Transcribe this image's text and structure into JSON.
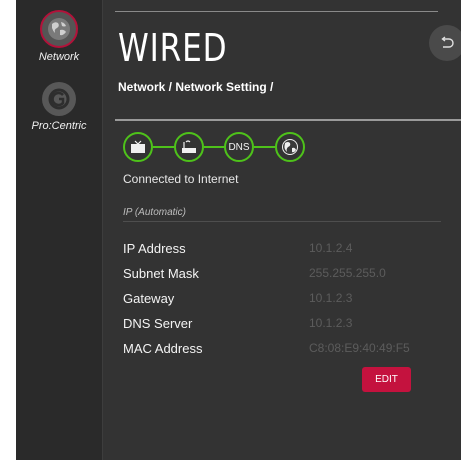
{
  "sidebar": {
    "items": [
      {
        "label": "Network",
        "icon": "network-globe-icon",
        "selected": true
      },
      {
        "label": "Pro:Centric",
        "icon": "procentric-logo-icon",
        "selected": false
      }
    ]
  },
  "header": {
    "title": "WIRED",
    "breadcrumb": "Network / Network Setting /"
  },
  "status": {
    "nodes": [
      "tv-icon",
      "router-icon",
      "DNS",
      "internet-globe-icon"
    ],
    "text": "Connected to Internet"
  },
  "ip_mode": "IP (Automatic)",
  "fields": [
    {
      "label": "IP Address",
      "value": "10.1.2.4"
    },
    {
      "label": "Subnet Mask",
      "value": "255.255.255.0"
    },
    {
      "label": "Gateway",
      "value": "10.1.2.3"
    },
    {
      "label": "DNS Server",
      "value": "10.1.2.3"
    },
    {
      "label": "MAC Address",
      "value": "C8:08:E9:40:49:F5"
    }
  ],
  "edit_label": "EDIT",
  "colors": {
    "accent": "#c4123e",
    "connected": "#4ec21a",
    "background": "#333333"
  }
}
